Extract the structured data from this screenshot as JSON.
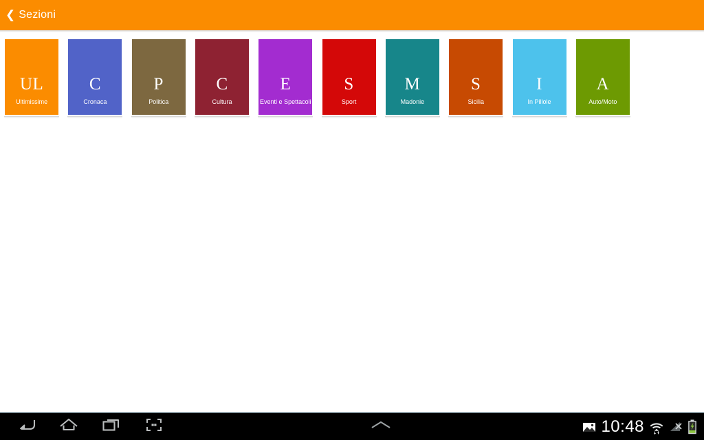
{
  "header": {
    "back_chevron": "❮",
    "back_label": "Sezioni",
    "background_color": "#fb8c00"
  },
  "sections": [
    {
      "initial": "UL",
      "label": "Ultimissime",
      "color": "#fb8c00"
    },
    {
      "initial": "C",
      "label": "Cronaca",
      "color": "#5163c8"
    },
    {
      "initial": "P",
      "label": "Politica",
      "color": "#7d6840"
    },
    {
      "initial": "C",
      "label": "Cultura",
      "color": "#8e2232"
    },
    {
      "initial": "E",
      "label": "Eventi e Spettacoli",
      "color": "#a32cd0"
    },
    {
      "initial": "S",
      "label": "Sport",
      "color": "#d40808"
    },
    {
      "initial": "M",
      "label": "Madonie",
      "color": "#17868a"
    },
    {
      "initial": "S",
      "label": "Sicilia",
      "color": "#c74a02"
    },
    {
      "initial": "I",
      "label": "In Pillole",
      "color": "#4dc2ec"
    },
    {
      "initial": "A",
      "label": "Auto/Moto",
      "color": "#6d9a02"
    }
  ],
  "system_bar": {
    "nav_buttons": [
      {
        "name": "back",
        "icon": "back-arrow-icon"
      },
      {
        "name": "home",
        "icon": "home-icon"
      },
      {
        "name": "recents",
        "icon": "recent-apps-icon"
      },
      {
        "name": "screenshot",
        "icon": "screenshot-icon"
      }
    ],
    "handle_icon": "chevron-up-icon",
    "clock": "10:48",
    "status_icons": [
      {
        "name": "screenshot-notification",
        "icon": "image-icon"
      },
      {
        "name": "wifi",
        "icon": "wifi-transfer-icon"
      },
      {
        "name": "signal",
        "icon": "signal-muted-icon"
      },
      {
        "name": "battery",
        "icon": "battery-charging-icon"
      }
    ],
    "battery_color": "#8cc63f"
  }
}
